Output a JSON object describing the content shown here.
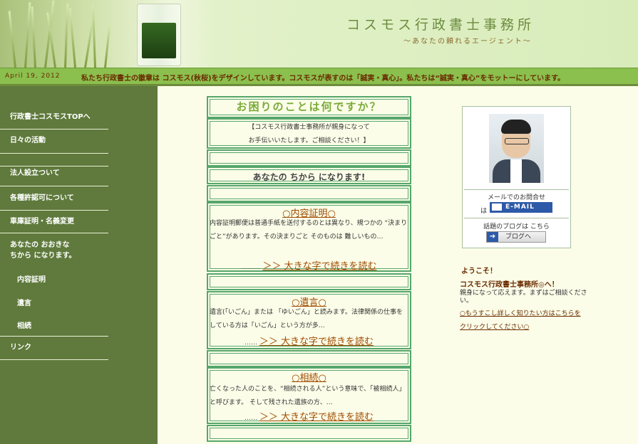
{
  "header": {
    "title": "コスモス行政書士事務所",
    "tagline": "〜あなたの頼れるエージェント〜"
  },
  "newsbar": {
    "date": "April 19, 2012",
    "text": "私たち行政書士の徽章は コスモス(秋桜)をデザインしています。コスモスが表すのは「誠実・真心」。私たちは“誠実・真心”をモットーにしています。"
  },
  "sidebar": {
    "items": [
      {
        "label": "行政書士コスモスTOPへ"
      },
      {
        "label": "日々の活動"
      },
      {
        "label": ""
      },
      {
        "label": "法人設立ついて"
      },
      {
        "label": "各種許認可について"
      },
      {
        "label": "車庫証明・名義変更"
      },
      {
        "label": "あなたの おおきな\nちから になります。"
      },
      {
        "label": "リンク"
      }
    ],
    "subitems": [
      {
        "label": "内容証明"
      },
      {
        "label": "遺言"
      },
      {
        "label": "相続"
      }
    ]
  },
  "main": {
    "heading": "お困りのことは何ですか？",
    "intro_line1": "【コスモス行政書士事務所が親身になって",
    "intro_line2": "お手伝いいたします。ご相談ください！】",
    "strong": "あなたの ちから になります!",
    "articles": [
      {
        "title": "○内容証明○",
        "body": "内容証明郵便は普通手紙を送付するのとは異なり、規つかの “決まりごと”があります。その決まりごと そのものは 難しいもの…",
        "ellipsis": "………",
        "more": "＞＞ 大きな字で続きを読む"
      },
      {
        "title": "○遺言○",
        "body": "遺言(「いごん」または 「ゆいごん」と読みます。法律関係の仕事をしている方は「いごん」という方が多…",
        "ellipsis": "……",
        "more": "＞＞ 大きな字で続きを読む"
      },
      {
        "title": "○相続○",
        "body": "亡くなった人のことを、“相続される人”という意味で、「被相続人」と呼びます。 そして残された遺族の方、…",
        "ellipsis": "……",
        "more": "＞＞ 大きな字で続きを読む"
      }
    ]
  },
  "profile": {
    "mail_label": "メールでのお問合せ",
    "mail_ha": "は",
    "email_button": "E-MAIL",
    "blog_label": "話題のブログは こちら",
    "blog_button": "ブログへ"
  },
  "welcome": {
    "title": "ようこそ！",
    "office": "コスモス行政書士事務所◎へ！",
    "body": "親身になって応えます。まずはご相談ください。",
    "link_line1": "○もうすこし詳しく知りたい方はこちらを",
    "link_line2": "クリックしてください○"
  },
  "colors": {
    "sidebar": "#5f7a3c",
    "newsbar": "#8bbf4e",
    "box_border": "#56a66c",
    "link_brown": "#a04a00",
    "page_bg": "#fbfde8"
  }
}
